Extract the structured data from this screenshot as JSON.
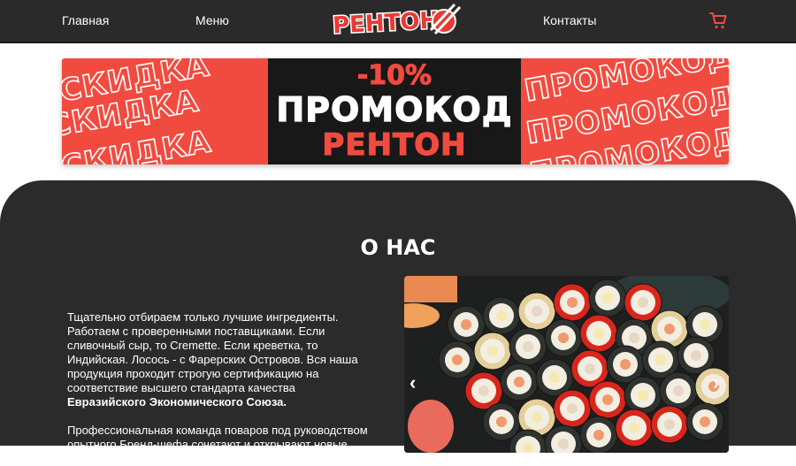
{
  "nav": {
    "home": "Главная",
    "menu": "Меню",
    "contacts": "Контакты",
    "logo_text": "РЕНТОН"
  },
  "banner": {
    "pattern_word_left": "СКИДКА",
    "pattern_word_right": "ПРОМОКОДУ",
    "discount": "-10%",
    "promo_word": "ПРОМОКОД",
    "promo_code": "РЕНТОН"
  },
  "about": {
    "title": "О НАС",
    "paragraph1_main": "Тщательно отбираем только лучшие ингредиенты. Работаем с проверенными поставщиками. Если сливочный сыр, то Cremette. Если креветка, то Индийская. Лосось - с Фарерских Островов. Вся наша продукция проходит строгую сертификацию на соответствие высшего стандарта качества",
    "paragraph1_bold": "Евразийского Экономического Союза.",
    "paragraph2": "Профессиональная команда поваров под руководством опытного Бренд-шефа сочетают и открывают новые",
    "prev_arrow": "‹",
    "next_arrow": "›"
  },
  "colors": {
    "accent": "#f14b3f",
    "dark": "#2b2a2a",
    "promo_box": "#191818"
  }
}
